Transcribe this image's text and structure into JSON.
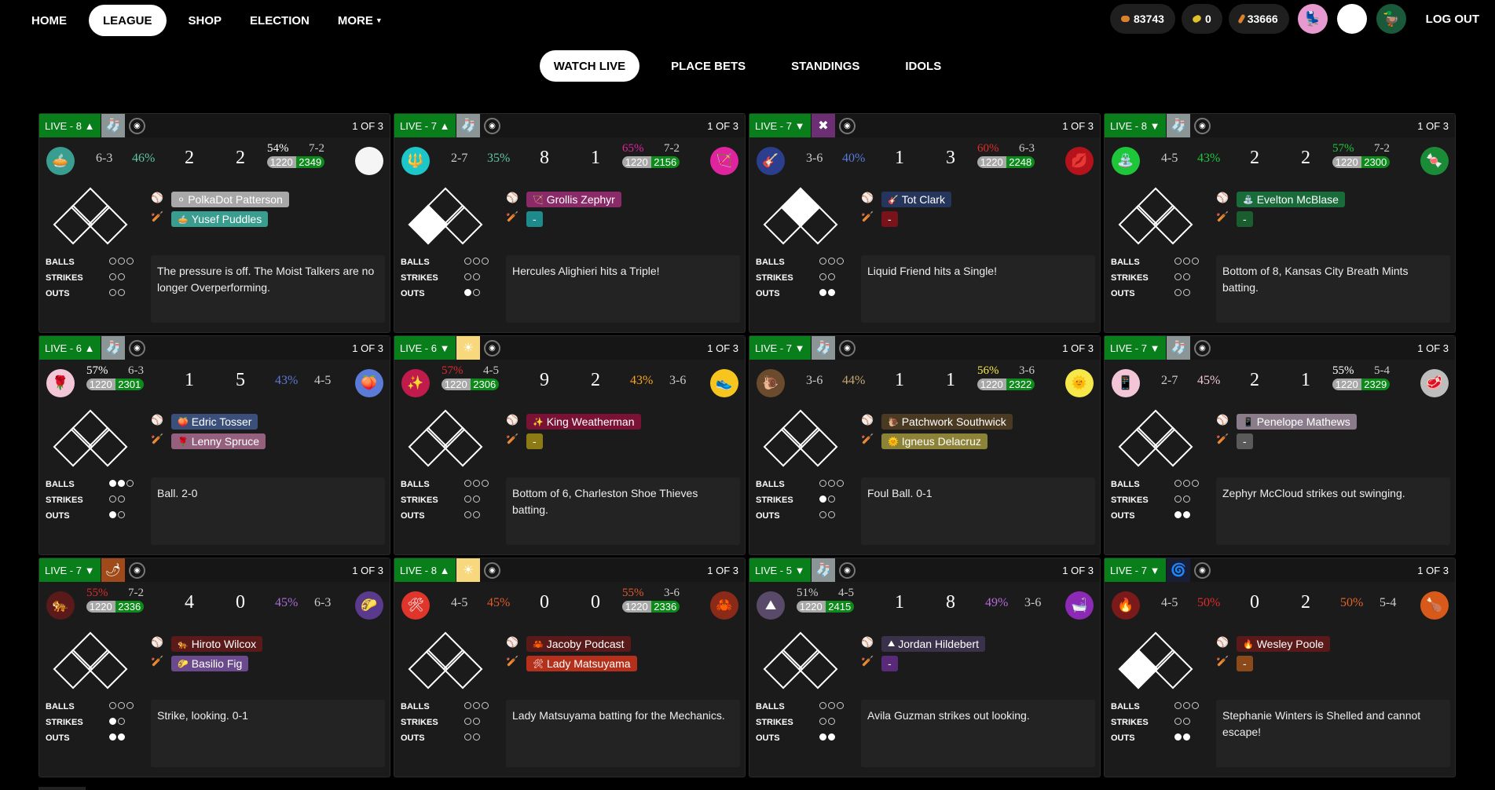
{
  "nav": {
    "links": [
      {
        "label": "HOME"
      },
      {
        "label": "LEAGUE",
        "active": true
      },
      {
        "label": "SHOP"
      },
      {
        "label": "ELECTION"
      },
      {
        "label": "MORE"
      }
    ],
    "coins": "83743",
    "votes": "0",
    "peanuts": "33666",
    "logout": "LOG OUT"
  },
  "subnav": [
    {
      "label": "WATCH LIVE",
      "active": true
    },
    {
      "label": "PLACE BETS"
    },
    {
      "label": "STANDINGS"
    },
    {
      "label": "IDOLS"
    }
  ],
  "count_labels": {
    "balls": "BALLS",
    "strikes": "STRIKES",
    "outs": "OUTS"
  },
  "games": [
    {
      "live": "LIVE - 8 ▲",
      "weather": "gray",
      "series": "1 OF 3",
      "away": {
        "logo": "🥧",
        "color": "#399d8f",
        "record": "6-3",
        "pct": "46%",
        "pct_color": "#5fc7a0",
        "score": "2"
      },
      "home": {
        "logo": "",
        "color": "#f5f5f5",
        "record": "7-2",
        "pct": "54%",
        "pct_color": "#fff",
        "score": "2",
        "stake": "1220",
        "bet": "2349"
      },
      "home_first": false,
      "pitcher": "PolkaDot Patterson",
      "pitcher_color": "#a8a8a8",
      "pitcher_emoji": "⚪",
      "batter": "Yusef Puddles",
      "batter_color": "#399d8f",
      "batter_emoji": "🥧",
      "balls": 0,
      "strikes": 0,
      "outs": 0,
      "bases": [
        0,
        0,
        0
      ],
      "update": "The pressure is off. The Moist Talkers are no longer Overperforming."
    },
    {
      "live": "LIVE - 7 ▲",
      "weather": "gray",
      "series": "1 OF 3",
      "away": {
        "logo": "🔱",
        "color": "#1dc7c9",
        "record": "2-7",
        "pct": "35%",
        "pct_color": "#5fc7a0",
        "score": "8"
      },
      "home": {
        "logo": "🏹",
        "color": "#e0239f",
        "record": "7-2",
        "pct": "65%",
        "pct_color": "#e0239f",
        "score": "1",
        "stake": "1220",
        "bet": "2156"
      },
      "home_first": false,
      "pitcher": "Grollis Zephyr",
      "pitcher_color": "#8a2a69",
      "pitcher_emoji": "🏹",
      "batter": "-",
      "batter_color": "#1d8a8c",
      "batter_emoji": "",
      "balls": 0,
      "strikes": 0,
      "outs": 1,
      "bases": [
        0,
        0,
        1
      ],
      "update": "Hercules Alighieri hits a Triple!"
    },
    {
      "live": "LIVE - 7 ▼",
      "weather": "purple",
      "series": "1 OF 3",
      "away": {
        "logo": "🎸",
        "color": "#2c3e8e",
        "record": "3-6",
        "pct": "40%",
        "pct_color": "#5a7bd8",
        "score": "1"
      },
      "home": {
        "logo": "💋",
        "color": "#b5121b",
        "record": "6-3",
        "pct": "60%",
        "pct_color": "#e02b2b",
        "score": "3",
        "stake": "1220",
        "bet": "2248"
      },
      "home_first": false,
      "pitcher": "Tot Clark",
      "pitcher_color": "#25355b",
      "pitcher_emoji": "🎸",
      "batter": "-",
      "batter_color": "#7a121a",
      "batter_emoji": "",
      "balls": 0,
      "strikes": 0,
      "outs": 2,
      "bases": [
        0,
        1,
        0
      ],
      "update": "Liquid Friend hits a Single!"
    },
    {
      "live": "LIVE - 8 ▼",
      "weather": "gray",
      "series": "1 OF 3",
      "away": {
        "logo": "⛲",
        "color": "#1ec73a",
        "record": "4-5",
        "pct": "43%",
        "pct_color": "#1ec73a",
        "score": "2"
      },
      "home": {
        "logo": "🍬",
        "color": "#1a8c38",
        "record": "7-2",
        "pct": "57%",
        "pct_color": "#1ec73a",
        "score": "2",
        "stake": "1220",
        "bet": "2300"
      },
      "home_first": false,
      "pitcher": "Evelton McBlase",
      "pitcher_color": "#1a6b3a",
      "pitcher_emoji": "⛲",
      "batter": "-",
      "batter_color": "#1a5e30",
      "batter_emoji": "",
      "balls": 0,
      "strikes": 0,
      "outs": 0,
      "bases": [
        0,
        0,
        0
      ],
      "update": "Bottom of 8, Kansas City Breath Mints batting."
    },
    {
      "live": "LIVE - 6 ▲",
      "weather": "gray",
      "series": "1 OF 3",
      "away": {
        "logo": "🌹",
        "color": "#f3c6d7",
        "record": "6-3",
        "pct": "57%",
        "pct_color": "#fff",
        "score": "1",
        "stake": "1220",
        "bet": "2301"
      },
      "home": {
        "logo": "🍑",
        "color": "#5a7bd8",
        "record": "4-5",
        "pct": "43%",
        "pct_color": "#5a7bd8",
        "score": "5"
      },
      "home_first": true,
      "pitcher": "Edric Tosser",
      "pitcher_color": "#3a4f7a",
      "pitcher_emoji": "🍑",
      "batter": "Lenny Spruce",
      "batter_color": "#94607e",
      "batter_emoji": "🌹",
      "balls": 2,
      "strikes": 0,
      "outs": 1,
      "bases": [
        0,
        0,
        0
      ],
      "update": "Ball. 2-0"
    },
    {
      "live": "LIVE - 6 ▼",
      "weather": "sun",
      "series": "1 OF 3",
      "away": {
        "logo": "✨",
        "color": "#c11a4d",
        "record": "4-5",
        "pct": "57%",
        "pct_color": "#e02b2b",
        "score": "9",
        "stake": "1220",
        "bet": "2306"
      },
      "home": {
        "logo": "👟",
        "color": "#f7c51e",
        "record": "3-6",
        "pct": "43%",
        "pct_color": "#f7a51e",
        "score": "2"
      },
      "home_first": true,
      "pitcher": "King Weatherman",
      "pitcher_color": "#7a1235",
      "pitcher_emoji": "✨",
      "batter": "-",
      "batter_color": "#8c7b14",
      "batter_emoji": "",
      "balls": 0,
      "strikes": 0,
      "outs": 0,
      "bases": [
        0,
        0,
        0
      ],
      "update": "Bottom of 6, Charleston Shoe Thieves batting."
    },
    {
      "live": "LIVE - 7 ▼",
      "weather": "gray",
      "series": "1 OF 3",
      "away": {
        "logo": "🐌",
        "color": "#6b4a2e",
        "record": "3-6",
        "pct": "44%",
        "pct_color": "#c9a870",
        "score": "1"
      },
      "home": {
        "logo": "🌞",
        "color": "#f7e84a",
        "record": "3-6",
        "pct": "56%",
        "pct_color": "#f7e84a",
        "score": "1",
        "stake": "1220",
        "bet": "2322"
      },
      "home_first": false,
      "pitcher": "Patchwork Southwick",
      "pitcher_color": "#4a3a22",
      "pitcher_emoji": "🐌",
      "batter": "Igneus Delacruz",
      "batter_color": "#8c8238",
      "batter_emoji": "🌞",
      "balls": 0,
      "strikes": 1,
      "outs": 0,
      "bases": [
        0,
        0,
        0
      ],
      "update": "Foul Ball. 0-1"
    },
    {
      "live": "LIVE - 7 ▼",
      "weather": "gray",
      "series": "1 OF 3",
      "away": {
        "logo": "📱",
        "color": "#f3c6d7",
        "record": "2-7",
        "pct": "45%",
        "pct_color": "#f3c6d7",
        "score": "2"
      },
      "home": {
        "logo": "🥩",
        "color": "#bdbdbd",
        "record": "5-4",
        "pct": "55%",
        "pct_color": "#fff",
        "score": "1",
        "stake": "1220",
        "bet": "2329"
      },
      "home_first": false,
      "pitcher": "Penelope Mathews",
      "pitcher_color": "#8a7c8a",
      "pitcher_emoji": "📱",
      "batter": "-",
      "batter_color": "#5a5a5a",
      "batter_emoji": "",
      "balls": 0,
      "strikes": 0,
      "outs": 2,
      "bases": [
        0,
        0,
        0
      ],
      "update": "Zephyr McCloud strikes out swinging."
    },
    {
      "live": "LIVE - 7 ▼",
      "weather": "orange",
      "series": "1 OF 3",
      "away": {
        "logo": "🐅",
        "color": "#5a1a1a",
        "record": "7-2",
        "pct": "55%",
        "pct_color": "#e02b2b",
        "score": "4",
        "stake": "1220",
        "bet": "2336"
      },
      "home": {
        "logo": "🌮",
        "color": "#5a3a8c",
        "record": "6-3",
        "pct": "45%",
        "pct_color": "#a86bd8",
        "score": "0"
      },
      "home_first": true,
      "pitcher": "Hiroto Wilcox",
      "pitcher_color": "#5a1a1a",
      "pitcher_emoji": "🐅",
      "batter": "Basilio Fig",
      "batter_color": "#6a4a8c",
      "batter_emoji": "🌮",
      "balls": 0,
      "strikes": 1,
      "outs": 2,
      "bases": [
        0,
        0,
        0
      ],
      "update": "Strike, looking. 0-1"
    },
    {
      "live": "LIVE - 8 ▲",
      "weather": "sun",
      "series": "1 OF 3",
      "away": {
        "logo": "🛠",
        "color": "#e0352b",
        "record": "4-5",
        "pct": "45%",
        "pct_color": "#e05a2b",
        "score": "0"
      },
      "home": {
        "logo": "🦀",
        "color": "#8c2a1a",
        "record": "3-6",
        "pct": "55%",
        "pct_color": "#e05a2b",
        "score": "0",
        "stake": "1220",
        "bet": "2336"
      },
      "home_first": false,
      "pitcher": "Jacoby Podcast",
      "pitcher_color": "#5a1a1a",
      "pitcher_emoji": "🦀",
      "batter": "Lady Matsuyama",
      "batter_color": "#b5301a",
      "batter_emoji": "🛠",
      "balls": 0,
      "strikes": 0,
      "outs": 0,
      "bases": [
        0,
        0,
        0
      ],
      "update": "Lady Matsuyama batting for the Mechanics."
    },
    {
      "live": "LIVE - 5 ▼",
      "weather": "gray",
      "series": "1 OF 3",
      "away": {
        "logo": "⛰",
        "color": "#5a4a6a",
        "record": "4-5",
        "pct": "51%",
        "pct_color": "#ccc",
        "score": "1",
        "stake": "1220",
        "bet": "2415"
      },
      "home": {
        "logo": "🛁",
        "color": "#8c2ab5",
        "record": "3-6",
        "pct": "49%",
        "pct_color": "#b56bd8",
        "score": "8"
      },
      "home_first": true,
      "pitcher": "Jordan Hildebert",
      "pitcher_color": "#3a324a",
      "pitcher_emoji": "⛰",
      "batter": "-",
      "batter_color": "#5a2a7a",
      "batter_emoji": "",
      "balls": 0,
      "strikes": 0,
      "outs": 2,
      "bases": [
        0,
        0,
        0
      ],
      "update": "Avila Guzman strikes out looking."
    },
    {
      "live": "LIVE - 7 ▼",
      "weather": "blue",
      "series": "1 OF 3",
      "away": {
        "logo": "🔥",
        "color": "#7a1a1a",
        "record": "4-5",
        "pct": "50%",
        "pct_color": "#e02b2b",
        "score": "0"
      },
      "home": {
        "logo": "🍗",
        "color": "#d85a1a",
        "record": "5-4",
        "pct": "50%",
        "pct_color": "#e0652b",
        "score": "2"
      },
      "home_first": false,
      "pitcher": "Wesley Poole",
      "pitcher_color": "#5a1a1a",
      "pitcher_emoji": "🔥",
      "batter": "-",
      "batter_color": "#8c4a1a",
      "batter_emoji": "",
      "balls": 0,
      "strikes": 0,
      "outs": 2,
      "bases": [
        0,
        0,
        1
      ],
      "update": "Stephanie Winters is Shelled and cannot escape!"
    }
  ]
}
